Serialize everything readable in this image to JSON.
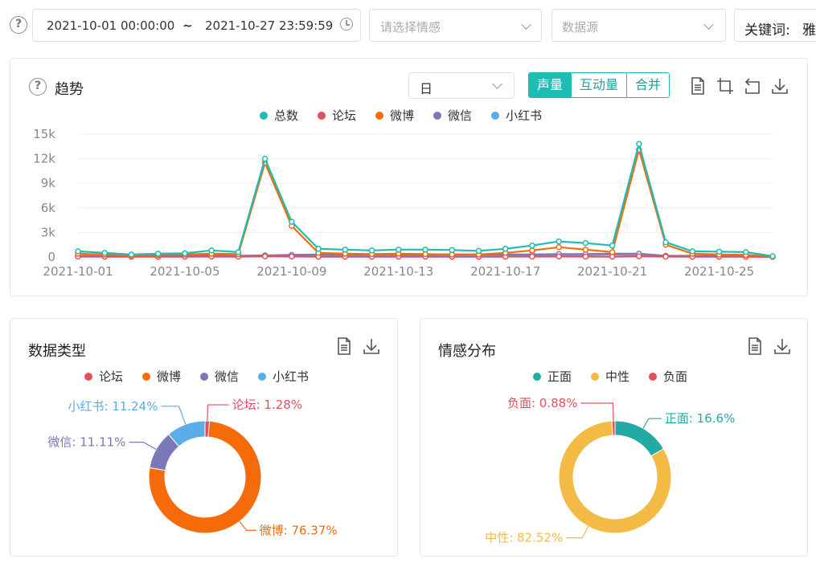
{
  "filters": {
    "date_start": "2021-10-01 00:00:00",
    "date_sep": "~",
    "date_end": "2021-10-27 23:59:59",
    "sentiment_placeholder": "请选择情感",
    "source_placeholder": "数据源",
    "keyword_label": "关键词:",
    "keyword_value": "雅"
  },
  "trend": {
    "title": "趋势",
    "granularity": "日",
    "tabs": [
      {
        "label": "声量",
        "active": true
      },
      {
        "label": "互动量",
        "active": false
      },
      {
        "label": "合并",
        "active": false
      }
    ]
  },
  "types": {
    "title": "数据类型"
  },
  "sentiment": {
    "title": "情感分布"
  },
  "colors": {
    "total": "#1ebdb4",
    "forum": "#e0505e",
    "weibo": "#f56b0a",
    "wechat": "#7b78b8",
    "xhs": "#5aade8",
    "positive": "#22aaa4",
    "neutral": "#f3bb45",
    "negative": "#e0505e"
  },
  "chart_data": [
    {
      "type": "line",
      "x": [
        "2021-10-01",
        "2021-10-02",
        "2021-10-03",
        "2021-10-04",
        "2021-10-05",
        "2021-10-06",
        "2021-10-07",
        "2021-10-08",
        "2021-10-09",
        "2021-10-10",
        "2021-10-11",
        "2021-10-12",
        "2021-10-13",
        "2021-10-14",
        "2021-10-15",
        "2021-10-16",
        "2021-10-17",
        "2021-10-18",
        "2021-10-19",
        "2021-10-20",
        "2021-10-21",
        "2021-10-22",
        "2021-10-23",
        "2021-10-24",
        "2021-10-25",
        "2021-10-26",
        "2021-10-27"
      ],
      "x_tick_labels": [
        "2021-10-01",
        "2021-10-05",
        "2021-10-09",
        "2021-10-13",
        "2021-10-17",
        "2021-10-21",
        "2021-10-25"
      ],
      "y_tick_labels": [
        "0",
        "3k",
        "6k",
        "9k",
        "12k",
        "15k"
      ],
      "ylim": [
        0,
        15000
      ],
      "grid": true,
      "legend_position": "top-center",
      "series": [
        {
          "name": "总数",
          "color_key": "total",
          "values": [
            700,
            500,
            300,
            400,
            450,
            800,
            600,
            12000,
            4300,
            1000,
            900,
            800,
            900,
            900,
            850,
            750,
            1000,
            1400,
            1900,
            1700,
            1400,
            13800,
            1800,
            700,
            650,
            600,
            100
          ]
        },
        {
          "name": "论坛",
          "color_key": "forum",
          "values": [
            50,
            40,
            30,
            30,
            40,
            50,
            40,
            80,
            60,
            40,
            40,
            30,
            40,
            40,
            30,
            30,
            40,
            50,
            60,
            50,
            40,
            90,
            50,
            30,
            30,
            30,
            10
          ]
        },
        {
          "name": "微博",
          "color_key": "weibo",
          "values": [
            400,
            300,
            200,
            250,
            300,
            400,
            350,
            11500,
            3800,
            500,
            400,
            350,
            400,
            350,
            300,
            300,
            500,
            800,
            1200,
            900,
            600,
            13100,
            1500,
            400,
            300,
            250,
            50
          ]
        },
        {
          "name": "微信",
          "color_key": "wechat",
          "values": [
            150,
            100,
            100,
            150,
            150,
            200,
            150,
            200,
            250,
            300,
            300,
            300,
            300,
            300,
            300,
            300,
            300,
            300,
            350,
            350,
            400,
            400,
            150,
            150,
            150,
            150,
            30
          ]
        },
        {
          "name": "小红书",
          "color_key": "xhs",
          "values": [
            100,
            80,
            80,
            100,
            100,
            120,
            100,
            120,
            150,
            150,
            150,
            150,
            150,
            150,
            150,
            150,
            150,
            200,
            250,
            250,
            300,
            200,
            100,
            100,
            100,
            100,
            20
          ]
        }
      ]
    },
    {
      "type": "pie",
      "slices": [
        {
          "name": "论坛",
          "value": 1.28,
          "label": "论坛: 1.28%",
          "color_key": "forum"
        },
        {
          "name": "微博",
          "value": 76.37,
          "label": "微博: 76.37%",
          "color_key": "weibo"
        },
        {
          "name": "微信",
          "value": 11.11,
          "label": "微信: 11.11%",
          "color_key": "wechat"
        },
        {
          "name": "小红书",
          "value": 11.24,
          "label": "小红书: 11.24%",
          "color_key": "xhs"
        }
      ]
    },
    {
      "type": "pie",
      "slices": [
        {
          "name": "正面",
          "value": 16.6,
          "label": "正面: 16.6%",
          "color_key": "positive"
        },
        {
          "name": "中性",
          "value": 82.52,
          "label": "中性: 82.52%",
          "color_key": "neutral"
        },
        {
          "name": "负面",
          "value": 0.88,
          "label": "负面: 0.88%",
          "color_key": "negative"
        }
      ]
    }
  ]
}
